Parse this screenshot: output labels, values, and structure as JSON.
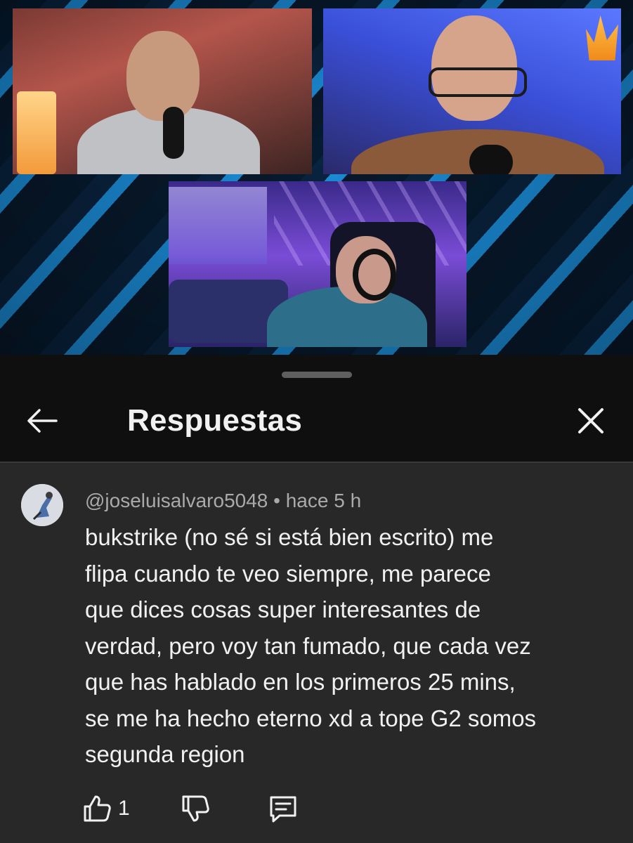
{
  "video": {
    "description_icons": [
      "webcam-feed",
      "webcam-feed",
      "webcam-feed"
    ]
  },
  "header": {
    "title": "Respuestas",
    "back_icon": "arrow-left-icon",
    "close_icon": "close-icon"
  },
  "comment": {
    "author": "@joseluisalvaro5048",
    "separator": "•",
    "time": "hace 5 h",
    "meta": "@joseluisalvaro5048 • hace 5 h",
    "text_lines": [
      "bukstrike (no sé si está bien escrito) me",
      "flipa cuando te veo siempre, me parece",
      "que dices cosas super interesantes de",
      "verdad, pero voy tan fumado, que cada vez",
      "que has hablado en los primeros 25 mins,",
      "se me ha hecho eterno xd a tope G2 somos",
      "segunda region"
    ],
    "like_count": "1",
    "like_icon": "thumbs-up-icon",
    "dislike_icon": "thumbs-down-icon",
    "reply_icon": "reply-comment-icon"
  },
  "colors": {
    "sheet_background": "#0f0f0f",
    "panel_background": "#282828",
    "primary_text": "#f1f1f1",
    "secondary_text": "#aaaaaa",
    "video_accent": "#1fa6ff"
  }
}
